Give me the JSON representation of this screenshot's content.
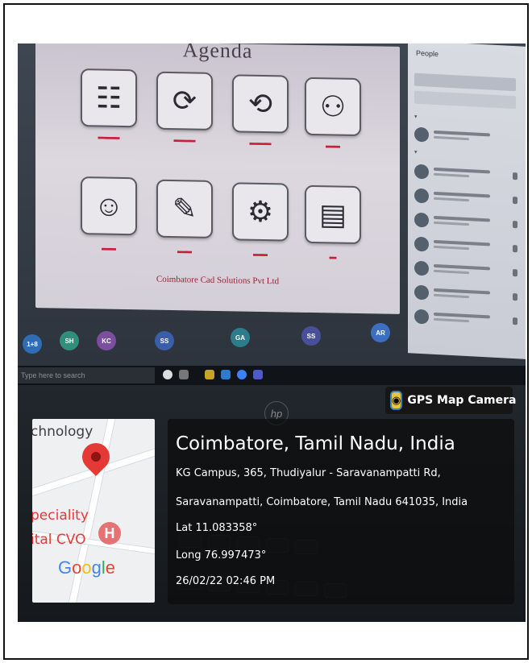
{
  "gps": {
    "app_label": "GPS Map Camera",
    "location_title": "Coimbatore, Tamil Nadu, India",
    "address_line1": "KG Campus, 365, Thudiyalur - Saravanampatti Rd,",
    "address_line2": "Saravanampatti, Coimbatore, Tamil Nadu 641035, India",
    "lat": "Lat 11.083358°",
    "long": "Long 76.997473°",
    "datetime": "26/02/22 02:46 PM"
  },
  "map": {
    "label_top": "chnology",
    "label_mid": "peciality",
    "label_low": "ital CVO",
    "google": [
      "G",
      "o",
      "o",
      "g",
      "l",
      "e"
    ],
    "google_colors": [
      "#4285F4",
      "#EA4335",
      "#FBBC05",
      "#4285F4",
      "#34A853",
      "#EA4335"
    ]
  },
  "slide": {
    "title": "Agenda",
    "footer": "Coimbatore Cad Solutions Pvt Ltd"
  },
  "taskbar": {
    "search_placeholder": "Type here to search"
  },
  "participants": [
    {
      "initials": "1+8",
      "color": "#2e6db4"
    },
    {
      "initials": "SH",
      "color": "#2f8f7a"
    },
    {
      "initials": "KC",
      "color": "#7b4fa0"
    },
    {
      "initials": "SS",
      "color": "#3a5ea8"
    },
    {
      "initials": "GA",
      "color": "#2c7d8c"
    },
    {
      "initials": "SS",
      "color": "#4a4f9a"
    },
    {
      "initials": "AR",
      "color": "#3d6fc0"
    }
  ],
  "panel": {
    "title": "People"
  },
  "logo": "hp"
}
